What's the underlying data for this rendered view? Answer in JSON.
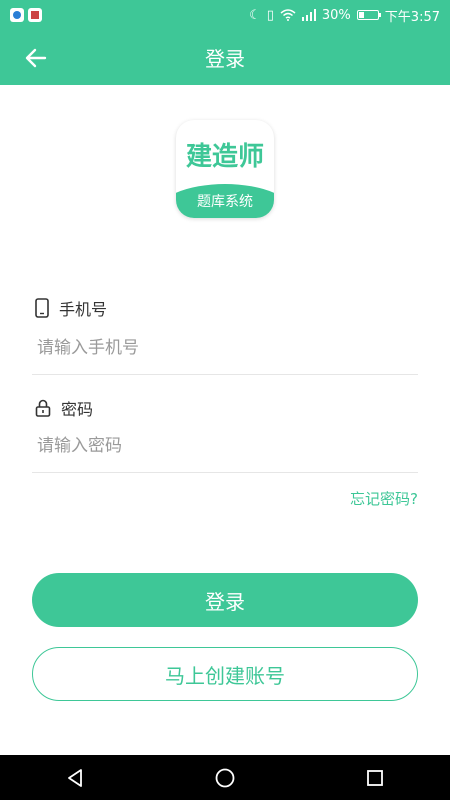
{
  "status_bar": {
    "signal_glyph": "☾",
    "battery_text": "30%",
    "battery_level": 0.3,
    "time": "下午3:57"
  },
  "header": {
    "title": "登录",
    "back_icon": "arrow-left-icon"
  },
  "logo": {
    "title": "建造师",
    "subtitle": "题库系统"
  },
  "form": {
    "phone": {
      "label": "手机号",
      "icon": "phone-icon",
      "placeholder": "请输入手机号",
      "value": ""
    },
    "password": {
      "label": "密码",
      "icon": "lock-icon",
      "placeholder": "请输入密码",
      "value": ""
    },
    "forgot_label": "忘记密码?"
  },
  "actions": {
    "login_label": "登录",
    "register_label": "马上创建账号"
  },
  "colors": {
    "accent": "#3ec797",
    "nav_background": "#000000"
  },
  "nav": {
    "back_icon": "triangle-back-icon",
    "home_icon": "circle-home-icon",
    "recents_icon": "square-recents-icon"
  }
}
